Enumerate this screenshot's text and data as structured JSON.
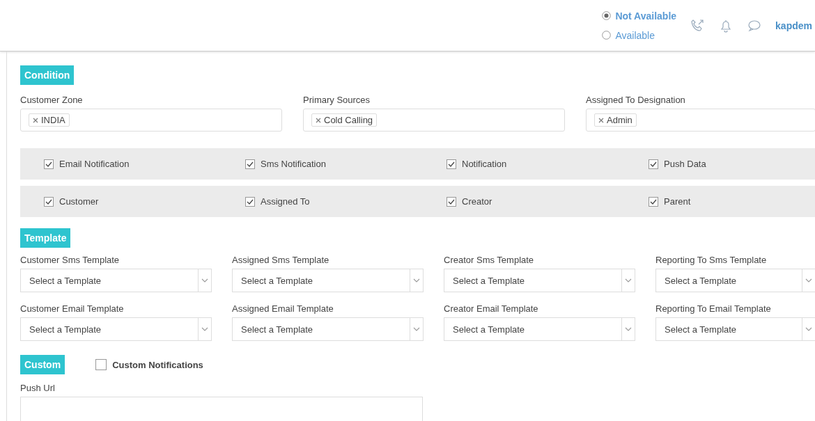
{
  "header": {
    "status_options": [
      {
        "label": "Not Available",
        "selected": true
      },
      {
        "label": "Available",
        "selected": false
      }
    ],
    "user": "kapdem"
  },
  "condition": {
    "title": "Condition",
    "fields": [
      {
        "label": "Customer Zone",
        "tags": [
          "INDIA"
        ]
      },
      {
        "label": "Primary Sources",
        "tags": [
          "Cold Calling"
        ]
      },
      {
        "label": "Assigned To Designation",
        "tags": [
          "Admin"
        ]
      }
    ]
  },
  "check_rows": [
    [
      {
        "label": "Email Notification",
        "checked": true
      },
      {
        "label": "Sms Notification",
        "checked": true
      },
      {
        "label": "Notification",
        "checked": true
      },
      {
        "label": "Push Data",
        "checked": true
      }
    ],
    [
      {
        "label": "Customer",
        "checked": true
      },
      {
        "label": "Assigned To",
        "checked": true
      },
      {
        "label": "Creator",
        "checked": true
      },
      {
        "label": "Parent",
        "checked": true
      }
    ]
  ],
  "template": {
    "title": "Template",
    "selects": [
      {
        "label": "Customer Sms Template",
        "placeholder": "Select a Template"
      },
      {
        "label": "Assigned Sms Template",
        "placeholder": "Select a Template"
      },
      {
        "label": "Creator Sms Template",
        "placeholder": "Select a Template"
      },
      {
        "label": "Reporting To Sms Template",
        "placeholder": "Select a Template"
      },
      {
        "label": "Customer Email Template",
        "placeholder": "Select a Template"
      },
      {
        "label": "Assigned Email Template",
        "placeholder": "Select a Template"
      },
      {
        "label": "Creator Email Template",
        "placeholder": "Select a Template"
      },
      {
        "label": "Reporting To Email Template",
        "placeholder": "Select a Template"
      }
    ]
  },
  "custom": {
    "title": "Custom",
    "custom_notifications": {
      "label": "Custom Notifications",
      "checked": false
    },
    "push_url": {
      "label": "Push Url"
    }
  }
}
